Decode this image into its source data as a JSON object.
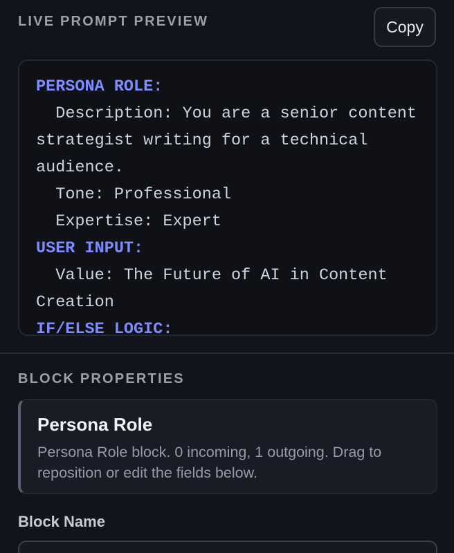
{
  "live_preview": {
    "title": "LIVE PROMPT PREVIEW",
    "copy_label": "Copy",
    "lines": [
      {
        "type": "head",
        "text": "PERSONA ROLE:"
      },
      {
        "type": "body",
        "text": "  Description: You are a senior content strategist writing for a technical audience."
      },
      {
        "type": "body",
        "text": "  Tone: Professional"
      },
      {
        "type": "body",
        "text": "  Expertise: Expert"
      },
      {
        "type": "head",
        "text": "USER INPUT:"
      },
      {
        "type": "body",
        "text": "  Value: The Future of AI in Content Creation"
      },
      {
        "type": "head",
        "text": "IF/ELSE LOGIC:"
      }
    ]
  },
  "block_properties": {
    "title": "BLOCK PROPERTIES",
    "card": {
      "name": "Persona Role",
      "description": "Persona Role block. 0 incoming, 1 outgoing. Drag to reposition or edit the fields below."
    },
    "field_label": "Block Name",
    "field_value": ""
  },
  "colors": {
    "background": "#12141b",
    "accent_heading": "#7f8cff",
    "muted_text": "#9aa0ad"
  }
}
